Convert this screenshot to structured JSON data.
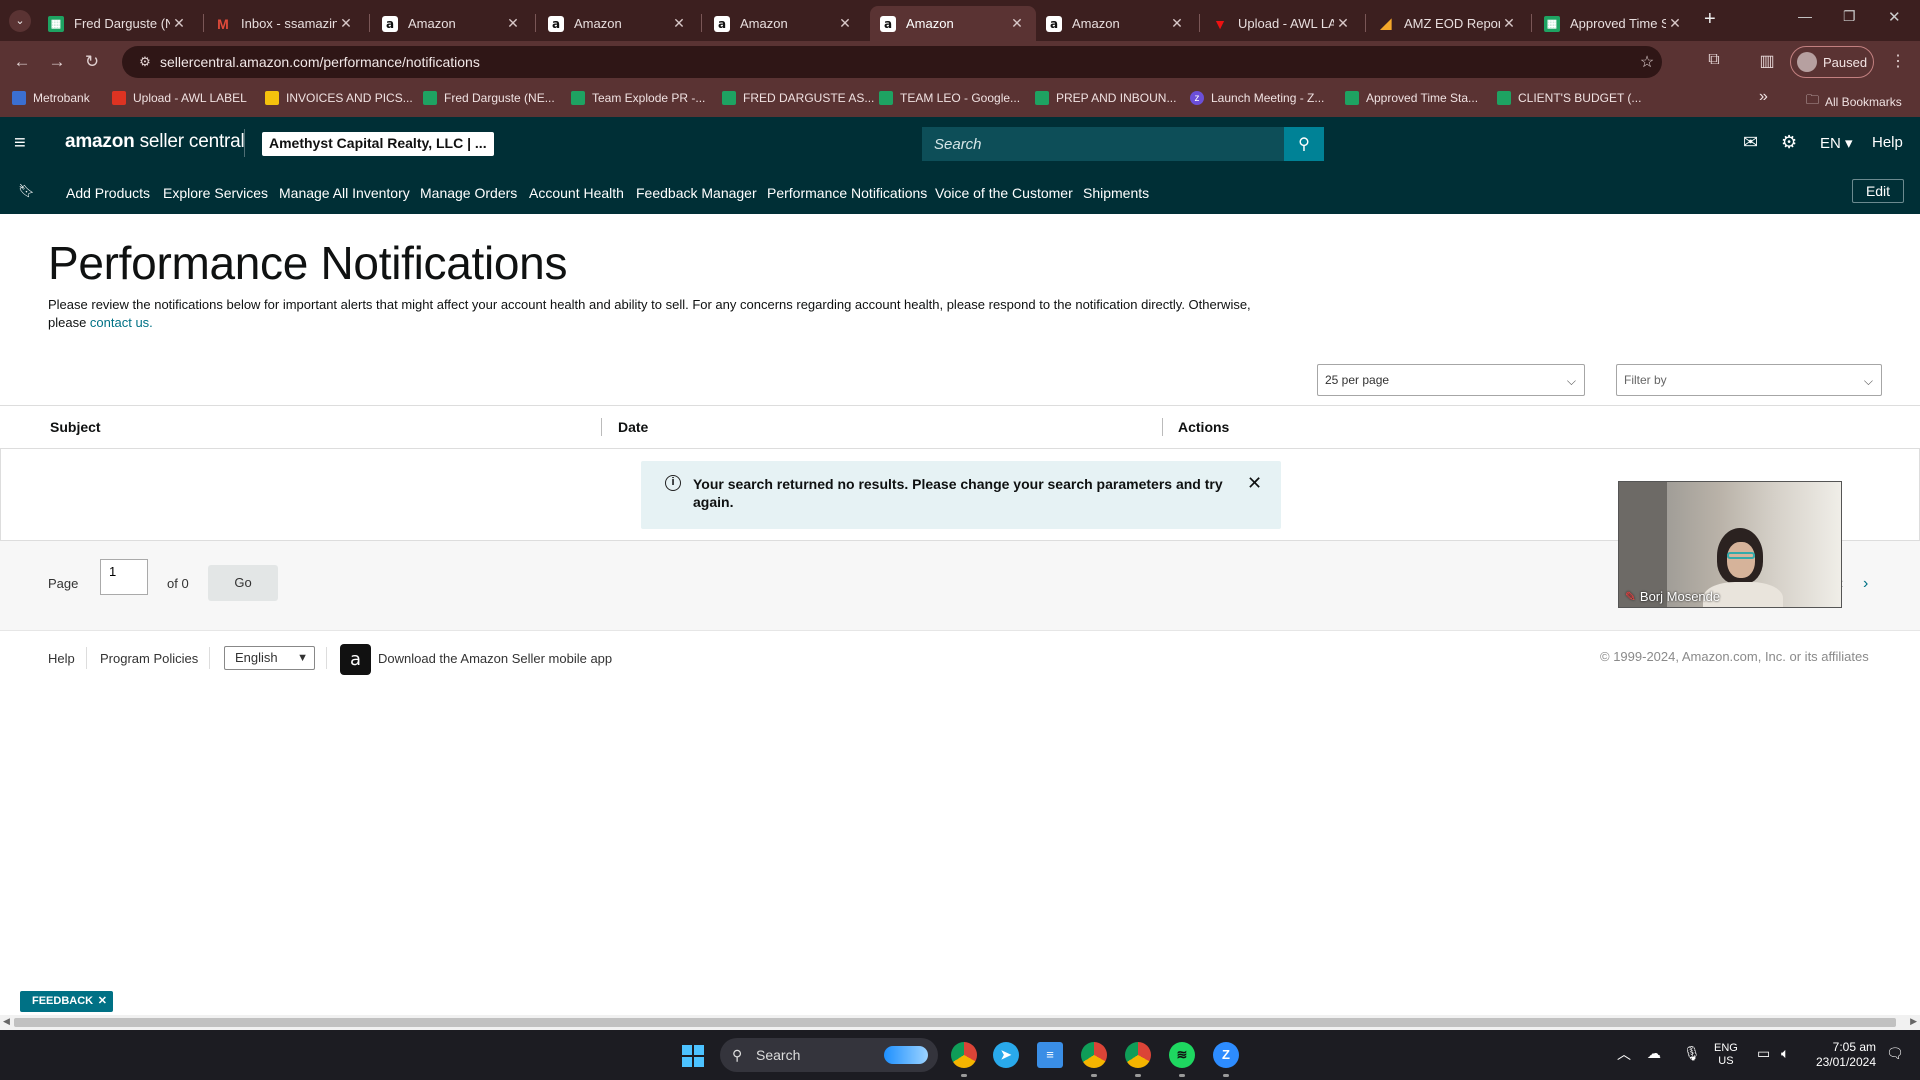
{
  "browser": {
    "tabs": [
      {
        "title": "Fred Darguste (NE",
        "icon": "sheets-icon",
        "active": false
      },
      {
        "title": "Inbox - ssamazing",
        "icon": "gmail-icon",
        "active": false
      },
      {
        "title": "Amazon",
        "icon": "amazon-icon",
        "active": false
      },
      {
        "title": "Amazon",
        "icon": "amazon-icon",
        "active": false
      },
      {
        "title": "Amazon",
        "icon": "amazon-icon",
        "active": false
      },
      {
        "title": "Amazon",
        "icon": "amazon-icon",
        "active": true
      },
      {
        "title": "Amazon",
        "icon": "amazon-icon",
        "active": false
      },
      {
        "title": "Upload - AWL LA",
        "icon": "upload-icon",
        "active": false
      },
      {
        "title": "AMZ EOD Report",
        "icon": "report-icon",
        "active": false
      },
      {
        "title": "Approved Time St",
        "icon": "sheets-icon",
        "active": false
      }
    ],
    "tab_close_glyph": "✕",
    "new_tab_glyph": "+",
    "url": "sellercentral.amazon.com/performance/notifications",
    "profile_label": "Paused",
    "bookmarks": [
      {
        "label": "Metrobank",
        "icon": "bank-icon"
      },
      {
        "label": "Upload - AWL LABEL",
        "icon": "upload-icon"
      },
      {
        "label": "INVOICES AND PICS...",
        "icon": "drive-icon"
      },
      {
        "label": "Fred Darguste (NE...",
        "icon": "sheets-icon"
      },
      {
        "label": "Team Explode PR -...",
        "icon": "sheets-icon"
      },
      {
        "label": "FRED DARGUSTE AS...",
        "icon": "sheets-icon"
      },
      {
        "label": "TEAM LEO - Google...",
        "icon": "sheets-icon"
      },
      {
        "label": "PREP AND INBOUN...",
        "icon": "sheets-icon"
      },
      {
        "label": "Launch Meeting - Z...",
        "icon": "zoom-icon"
      },
      {
        "label": "Approved Time Sta...",
        "icon": "sheets-icon"
      },
      {
        "label": "CLIENT'S BUDGET (...",
        "icon": "sheets-icon"
      }
    ],
    "bookmarks_overflow": "»",
    "all_bookmarks_label": "All Bookmarks"
  },
  "header": {
    "logo_amazon": "amazon",
    "logo_rest": " seller central",
    "account": "Amethyst Capital Realty, LLC | ...",
    "search_placeholder": "Search",
    "lang": "EN ▾",
    "help": "Help"
  },
  "nav": {
    "items": [
      "Add Products",
      "Explore Services",
      "Manage All Inventory",
      "Manage Orders",
      "Account Health",
      "Feedback Manager",
      "Performance Notifications",
      "Voice of the Customer",
      "Shipments"
    ],
    "edit": "Edit"
  },
  "page": {
    "title": "Performance Notifications",
    "intro": "Please review the notifications below for important alerts that might affect your account health and ability to sell. For any concerns regarding account health, please respond to the notification directly. Otherwise, please ",
    "intro_link": "contact us.",
    "per_page": "25 per page",
    "filter": "Filter by"
  },
  "table": {
    "columns": [
      "Subject",
      "Date",
      "Actions"
    ],
    "empty_message": "Your search returned no results. Please change your search parameters and try again."
  },
  "pager": {
    "label": "Page",
    "current_page": "1",
    "of_text": "of 0",
    "go": "Go"
  },
  "video_overlay": {
    "name": "Borj Mosende"
  },
  "footer": {
    "help": "Help",
    "policies": "Program Policies",
    "language": "English",
    "app_text": "Download the Amazon Seller mobile app",
    "copyright": "© 1999-2024, Amazon.com, Inc. or its affiliates"
  },
  "feedback": {
    "label": "FEEDBACK",
    "close": "✕"
  },
  "taskbar": {
    "search": "Search",
    "lang_line1": "ENG",
    "lang_line2": "US",
    "time": "7:05 am",
    "date": "23/01/2024"
  },
  "colors": {
    "browser_frame": "#3c1f1f",
    "toolbar": "#5a3333",
    "seller_header": "#002f36",
    "search_button": "#008296",
    "link": "#007185",
    "alert_bg": "#e6f2f4"
  }
}
